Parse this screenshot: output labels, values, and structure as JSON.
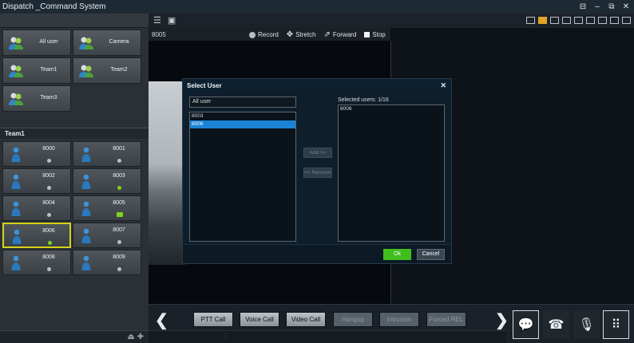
{
  "window": {
    "title": "Dispatch _Command System",
    "controls": [
      "⊟",
      "–",
      "⧉",
      "✕"
    ]
  },
  "groups": [
    {
      "label": "All user"
    },
    {
      "label": "Camera"
    },
    {
      "label": "Team1"
    },
    {
      "label": "Team2"
    },
    {
      "label": "Team3"
    }
  ],
  "team_header": "Team1",
  "users": [
    {
      "label": "8000",
      "status": "gray"
    },
    {
      "label": "8001",
      "status": "gray"
    },
    {
      "label": "8002",
      "status": "gray"
    },
    {
      "label": "8003",
      "status": "green"
    },
    {
      "label": "8004",
      "status": "gray"
    },
    {
      "label": "8005",
      "status": "camera"
    },
    {
      "label": "8006",
      "status": "green",
      "selected": true
    },
    {
      "label": "8007",
      "status": "gray"
    },
    {
      "label": "8008",
      "status": "gray"
    },
    {
      "label": "8009",
      "status": "gray"
    }
  ],
  "pane": {
    "id": "8005",
    "record": "Record",
    "stretch": "Stretch",
    "forward": "Forward",
    "stop": "Stop"
  },
  "dialog": {
    "title": "Select User",
    "close": "✕",
    "search_value": "All user",
    "available": [
      "8003",
      "8006"
    ],
    "add_label": "Add >>",
    "remove_label": "<< Remove",
    "selected_count": "Selected users: 1/16",
    "selected": [
      "8006"
    ],
    "ok_label": "Ok",
    "cancel_label": "Cancel"
  },
  "callbar": {
    "prev": "❮",
    "next": "❯",
    "buttons": [
      {
        "label": "PTT Call",
        "enabled": true
      },
      {
        "label": "Voice Call",
        "enabled": true
      },
      {
        "label": "Video Call",
        "enabled": true
      },
      {
        "label": "Hangup",
        "enabled": false
      },
      {
        "label": "Intrusion",
        "enabled": false
      },
      {
        "label": "Forced REL",
        "enabled": false
      }
    ]
  },
  "colors": {
    "accent_green": "#3fbe1e",
    "select_blue": "#1a83d6",
    "selected_tile_border": "#d6d21a"
  }
}
